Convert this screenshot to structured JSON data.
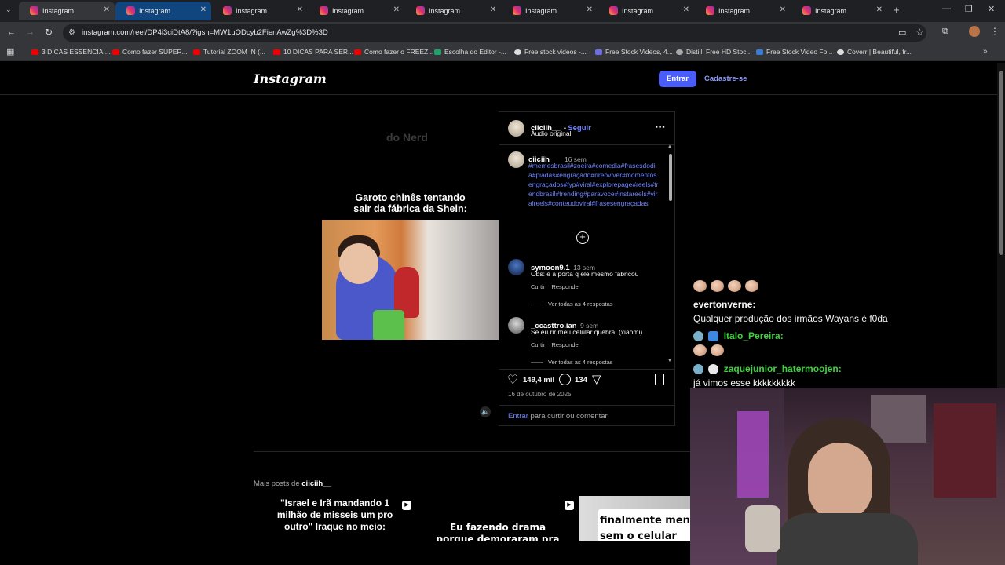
{
  "browser": {
    "tabs": [
      "Instagram",
      "Instagram",
      "Instagram",
      "Instagram",
      "Instagram",
      "Instagram",
      "Instagram",
      "Instagram",
      "Instagram"
    ],
    "url": "instagram.com/reel/DP4i3ciDtA8/?igsh=MW1uODcyb2FienAwZg%3D%3D",
    "bookmarks": [
      "3 DICAS ESSENCIAI...",
      "Como fazer SUPER...",
      "Tutorial ZOOM IN (...",
      "10 DICAS PARA SER...",
      "Como fazer o FREEZ...",
      "Escolha do Editor -...",
      "Free stock videos -...",
      "Free Stock Videos, 4...",
      "Distill: Free HD Stoc...",
      "Free Stock Video Fo...",
      "Coverr | Beautiful, fr..."
    ]
  },
  "header": {
    "logo": "Instagram",
    "login": "Entrar",
    "signup": "Cadastre-se"
  },
  "video": {
    "watermark": "do Nerd",
    "caption": "Garoto chinês tentando sair da fábrica da Shein:"
  },
  "post": {
    "author": "ciiciih__",
    "follow": "Seguir",
    "audio": "Áudio original",
    "caption_author": "ciiciih__",
    "caption_time": "16 sem",
    "hashtags": "#memesbrasil#zoeira#comedia#frasesdodia#piadas#engraçado#riréoviver#momentosengraçados#fyp#viral#explorepage#reels#trendbrasil#trending#paravoce#instareels#viralreels#conteudoviral#frasesengraçadas",
    "comments": [
      {
        "user": "symoon9.1",
        "time": "13 sem",
        "text": "Obs: é a porta q ele mesmo fabricou",
        "like": "Curtir",
        "reply": "Responder",
        "replies": "Ver todas as 4 respostas"
      },
      {
        "user": "_ccasttro.ian",
        "time": "9 sem",
        "text": "Se eu rir meu celular quebra. (xiaomi)",
        "like": "Curtir",
        "reply": "Responder",
        "replies": "Ver todas as 4 respostas"
      }
    ],
    "likes": "149,4 mil",
    "comment_count": "134",
    "date": "16 de outubro de 2025",
    "login_link": "Entrar",
    "login_text": "para curtir ou comentar."
  },
  "more_posts": {
    "label_prefix": "Mais posts de",
    "label_user": "ciiciih__",
    "thumbs": [
      "\"Israel e Irã mandando 1 milhão de misseis um pro outro\" Iraque no meio:",
      "Eu fazendo drama porque demoraram pra responder",
      "finalmente men sem o celular"
    ]
  },
  "chat": [
    {
      "user": "evertonverne:",
      "message": "Qualquer produção dos irmãos Wayans é f0da",
      "color": "#ffffff"
    },
    {
      "user": "Italo_Pereira:",
      "message": "",
      "color": "#3fd13f"
    },
    {
      "user": "zaquejunior_hatermoojen:",
      "message": "já vimos esse kkkkkkkkk",
      "color": "#3fd13f"
    }
  ]
}
